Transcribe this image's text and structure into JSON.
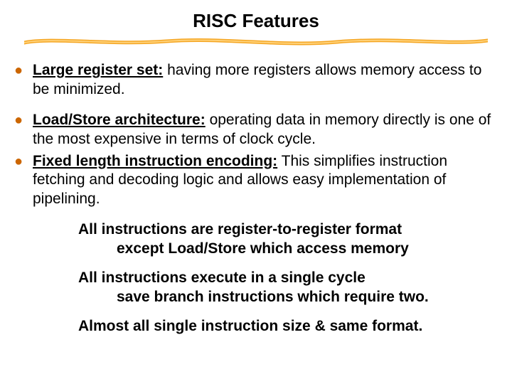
{
  "slide": {
    "title": "RISC Features",
    "bullets": [
      {
        "term": "Large register set:",
        "rest": " having more registers allows memory access to be minimized."
      },
      {
        "term": "Load/Store architecture:",
        "rest": " operating data in memory directly is one of the most expensive in terms of clock cycle."
      },
      {
        "term": "Fixed length instruction encoding:",
        "rest": " This simplifies instruction fetching and decoding logic and allows easy implementation of pipelining."
      }
    ],
    "subs": [
      {
        "l1": "All instructions are register-to-register format",
        "l2": "except Load/Store which access memory"
      },
      {
        "l1": "All instructions execute in a single cycle",
        "l2": "save branch instructions which require two."
      },
      {
        "l1": "Almost all single instruction size & same format.",
        "l2": ""
      }
    ]
  }
}
